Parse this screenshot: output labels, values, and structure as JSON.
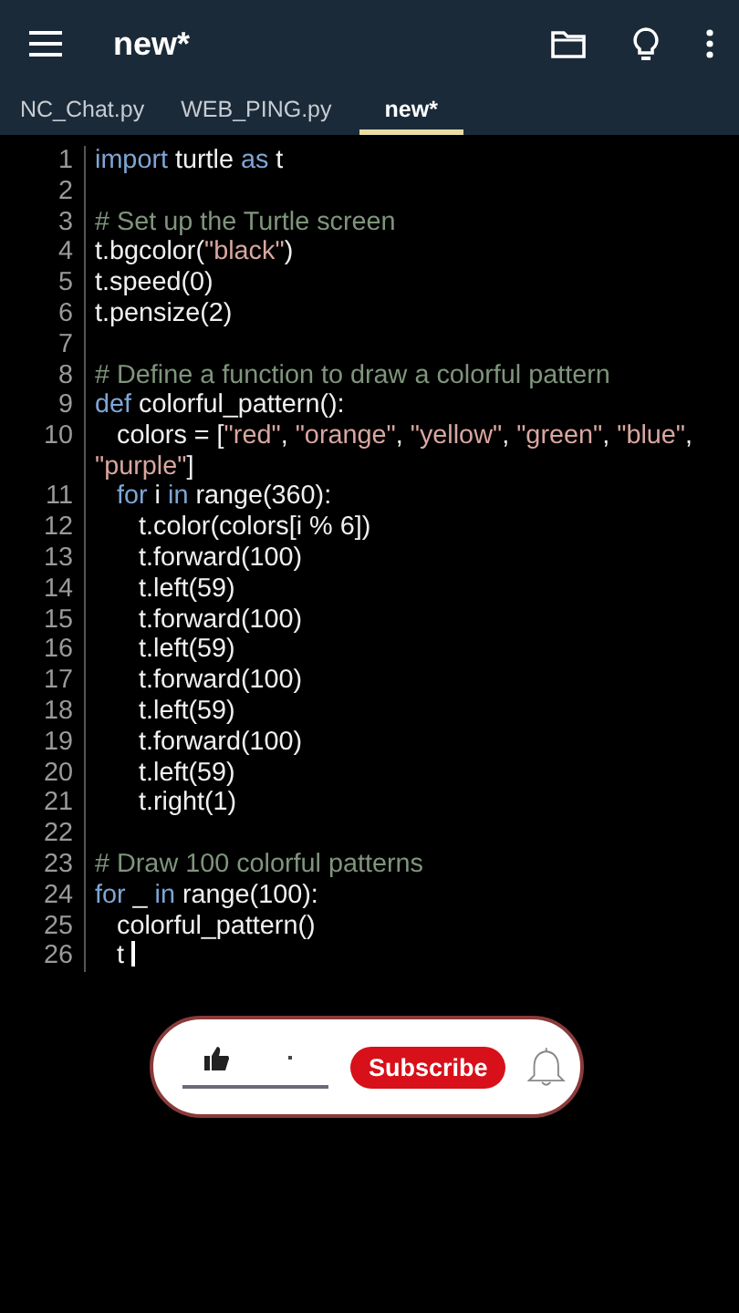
{
  "app_bar": {
    "title": "new*"
  },
  "tabs": [
    {
      "label": "NC_Chat.py",
      "selected": false
    },
    {
      "label": "WEB_PING.py",
      "selected": false
    },
    {
      "label": "new*",
      "selected": true
    }
  ],
  "editor": {
    "lines": [
      {
        "number": "1",
        "cursor": false,
        "tokens": [
          {
            "kind": "keyword",
            "text": "import"
          },
          {
            "kind": "plain",
            "text": " turtle "
          },
          {
            "kind": "keyword",
            "text": "as"
          },
          {
            "kind": "plain",
            "text": " t"
          }
        ]
      },
      {
        "number": "2",
        "cursor": false
      },
      {
        "number": "3",
        "cursor": false,
        "tokens": [
          {
            "kind": "comment",
            "text": "# Set up the Turtle screen"
          }
        ]
      },
      {
        "number": "4",
        "cursor": false,
        "tokens": [
          {
            "kind": "plain",
            "text": "t.bgcolor("
          },
          {
            "kind": "string",
            "text": "\"black\""
          },
          {
            "kind": "plain",
            "text": ")"
          }
        ]
      },
      {
        "number": "5",
        "cursor": false,
        "tokens": [
          {
            "kind": "plain",
            "text": "t.speed(0)"
          }
        ]
      },
      {
        "number": "6",
        "cursor": false,
        "tokens": [
          {
            "kind": "plain",
            "text": "t.pensize(2)"
          }
        ]
      },
      {
        "number": "7",
        "cursor": false
      },
      {
        "number": "8",
        "cursor": false,
        "tokens": [
          {
            "kind": "comment",
            "text": "# Define a function to draw a colorful pattern"
          }
        ]
      },
      {
        "number": "9",
        "cursor": false,
        "tokens": [
          {
            "kind": "keyword",
            "text": "def"
          },
          {
            "kind": "plain",
            "text": " colorful_pattern():"
          }
        ]
      },
      {
        "number": "10",
        "cursor": false,
        "tokens": [
          {
            "kind": "plain",
            "text": "   colors = ["
          },
          {
            "kind": "string",
            "text": "\"red\""
          },
          {
            "kind": "plain",
            "text": ", "
          },
          {
            "kind": "string",
            "text": "\"orange\""
          },
          {
            "kind": "plain",
            "text": ", "
          },
          {
            "kind": "string",
            "text": "\"yellow\""
          },
          {
            "kind": "plain",
            "text": ", "
          },
          {
            "kind": "string",
            "text": "\"green\""
          },
          {
            "kind": "plain",
            "text": ", "
          },
          {
            "kind": "string",
            "text": "\"blue\""
          },
          {
            "kind": "plain",
            "text": ", "
          },
          {
            "kind": "string",
            "text": "\"purple\""
          },
          {
            "kind": "plain",
            "text": "]"
          }
        ]
      },
      {
        "number": "11",
        "cursor": false,
        "tokens": [
          {
            "kind": "keyword",
            "text": "   for"
          },
          {
            "kind": "plain",
            "text": " i "
          },
          {
            "kind": "keyword",
            "text": "in"
          },
          {
            "kind": "plain",
            "text": " range(360):"
          }
        ]
      },
      {
        "number": "12",
        "cursor": false,
        "tokens": [
          {
            "kind": "plain",
            "text": "      t.color(colors[i % 6])"
          }
        ]
      },
      {
        "number": "13",
        "cursor": false,
        "tokens": [
          {
            "kind": "plain",
            "text": "      t.forward(100)"
          }
        ]
      },
      {
        "number": "14",
        "cursor": false,
        "tokens": [
          {
            "kind": "plain",
            "text": "      t.left(59)"
          }
        ]
      },
      {
        "number": "15",
        "cursor": false,
        "tokens": [
          {
            "kind": "plain",
            "text": "      t.forward(100)"
          }
        ]
      },
      {
        "number": "16",
        "cursor": false,
        "tokens": [
          {
            "kind": "plain",
            "text": "      t.left(59)"
          }
        ]
      },
      {
        "number": "17",
        "cursor": false,
        "tokens": [
          {
            "kind": "plain",
            "text": "      t.forward(100)"
          }
        ]
      },
      {
        "number": "18",
        "cursor": false,
        "tokens": [
          {
            "kind": "plain",
            "text": "      t.left(59)"
          }
        ]
      },
      {
        "number": "19",
        "cursor": false,
        "tokens": [
          {
            "kind": "plain",
            "text": "      t.forward(100)"
          }
        ]
      },
      {
        "number": "20",
        "cursor": false,
        "tokens": [
          {
            "kind": "plain",
            "text": "      t.left(59)"
          }
        ]
      },
      {
        "number": "21",
        "cursor": false,
        "tokens": [
          {
            "kind": "plain",
            "text": "      t.right(1)"
          }
        ]
      },
      {
        "number": "22",
        "cursor": false
      },
      {
        "number": "23",
        "cursor": false,
        "tokens": [
          {
            "kind": "comment",
            "text": "# Draw 100 colorful patterns"
          }
        ]
      },
      {
        "number": "24",
        "cursor": false,
        "tokens": [
          {
            "kind": "keyword",
            "text": "for"
          },
          {
            "kind": "plain",
            "text": " _ "
          },
          {
            "kind": "keyword",
            "text": "in"
          },
          {
            "kind": "plain",
            "text": " range(100):"
          }
        ]
      },
      {
        "number": "25",
        "cursor": false,
        "tokens": [
          {
            "kind": "plain",
            "text": "   colorful_pattern()"
          }
        ]
      },
      {
        "number": "26",
        "cursor": true,
        "tokens": [
          {
            "kind": "plain",
            "text": "   t"
          }
        ]
      }
    ]
  },
  "subscribe_overlay": {
    "button": "Subscribe"
  }
}
